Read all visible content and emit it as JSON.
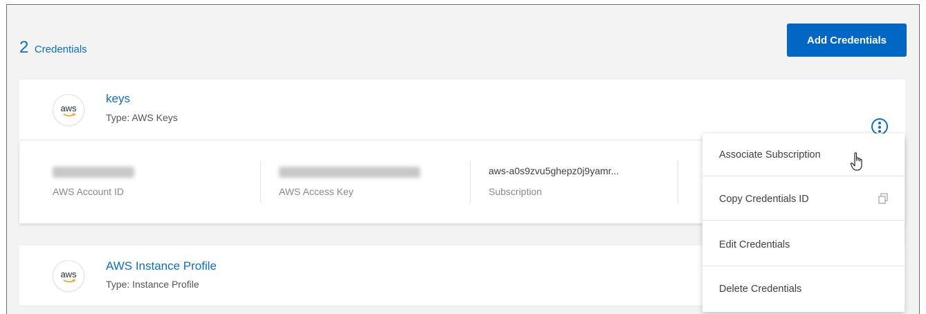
{
  "header": {
    "count": "2",
    "count_label": "Credentials",
    "add_button_label": "Add Credentials"
  },
  "credentials": [
    {
      "logo_text": "aws",
      "name": "keys",
      "type": "Type: AWS Keys",
      "details": {
        "account_id_label": "AWS Account ID",
        "access_key_label": "AWS Access Key",
        "subscription_value": "aws-a0s9zvu5ghepz0j9yamr...",
        "subscription_label": "Subscription"
      }
    },
    {
      "logo_text": "aws",
      "name": "AWS Instance Profile",
      "type": "Type: Instance Profile"
    }
  ],
  "actions_menu": {
    "items": [
      {
        "label": "Associate Subscription"
      },
      {
        "label": "Copy Credentials ID",
        "icon": "copy-icon"
      },
      {
        "label": "Edit Credentials"
      },
      {
        "label": "Delete Credentials"
      }
    ]
  },
  "colors": {
    "accent": "#0b6fc7",
    "button": "#0067c5",
    "background": "#f3f3f3"
  },
  "icons": {
    "more_actions": "more-vertical-icon",
    "logo": "aws-logo-icon",
    "pointer": "hand-pointer-cursor"
  }
}
